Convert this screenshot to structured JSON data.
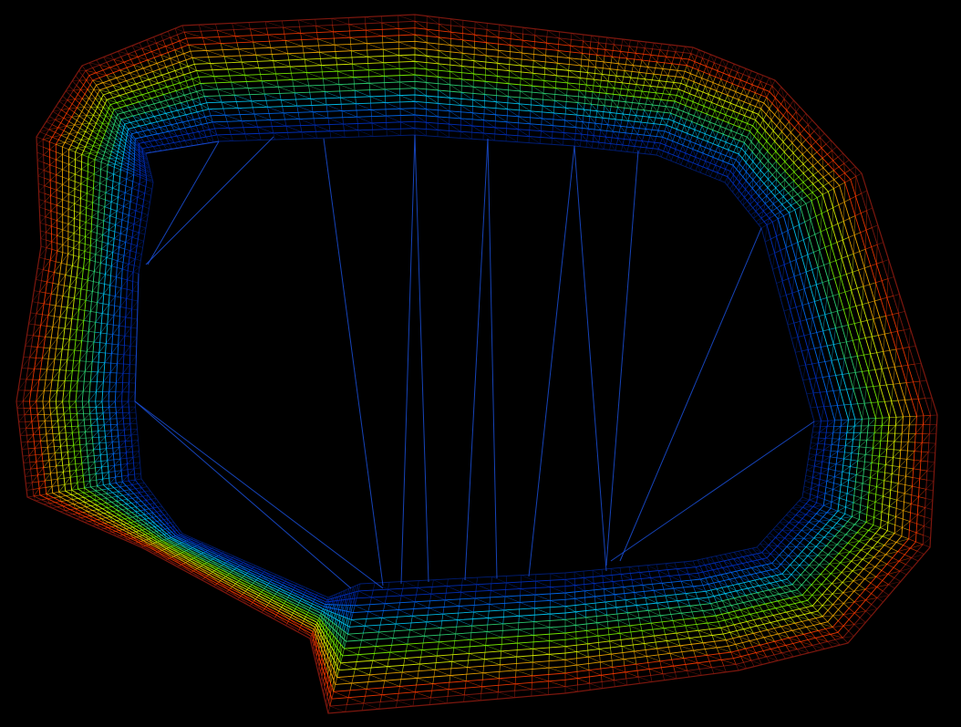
{
  "scene": {
    "background": "#000000",
    "description_kind": "wireframe mesh render",
    "colormap": [
      "#00207f",
      "#0033cc",
      "#0070ff",
      "#00d0ff",
      "#2fe07a",
      "#7fff00",
      "#e8ff00",
      "#ffb000",
      "#ff3a00",
      "#8a1a10"
    ],
    "inner_fan_color": "#1a4fd8",
    "band_layers": 18
  }
}
